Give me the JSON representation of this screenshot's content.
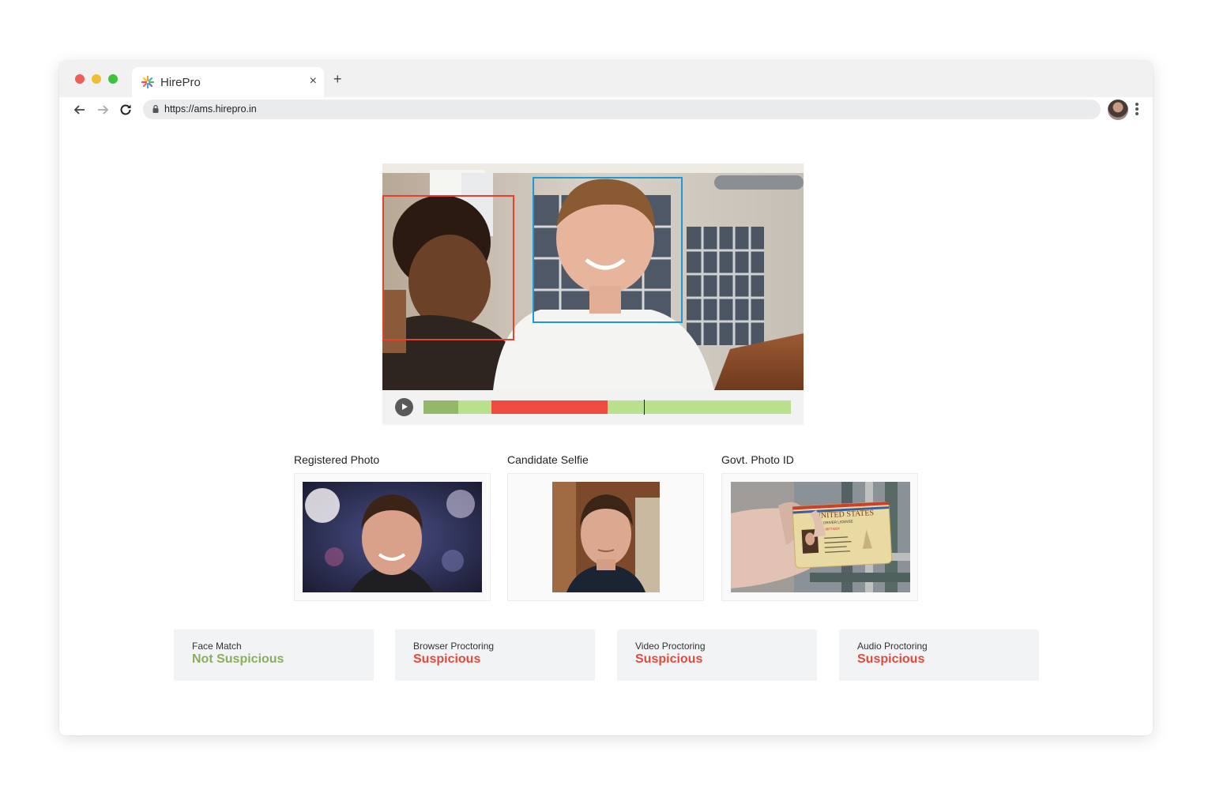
{
  "browser": {
    "tab_title": "HirePro",
    "close_glyph": "×",
    "new_tab_glyph": "+",
    "url": "https://ams.hirepro.in"
  },
  "video": {
    "timeline": {
      "segments": [
        {
          "start": 0.0,
          "end": 0.095,
          "color": "#94b86a"
        },
        {
          "start": 0.095,
          "end": 0.185,
          "color": "#b9e08d"
        },
        {
          "start": 0.185,
          "end": 0.502,
          "color": "#ef4b40"
        },
        {
          "start": 0.502,
          "end": 1.0,
          "color": "#b9e08d"
        }
      ],
      "playhead": 0.6
    }
  },
  "photos": {
    "registered": {
      "label": "Registered Photo"
    },
    "selfie": {
      "label": "Candidate Selfie"
    },
    "govt_id": {
      "label": "Govt. Photo ID",
      "card_title": "UNITED STATES",
      "card_subtitle": "DRIVER LICENSE",
      "card_number": "DL 0077422X"
    }
  },
  "status": [
    {
      "label": "Face Match",
      "value": "Not Suspicious",
      "color": "#8aaf5a"
    },
    {
      "label": "Browser Proctoring",
      "value": "Suspicious",
      "color": "#e34a3c"
    },
    {
      "label": "Video Proctoring",
      "value": "Suspicious",
      "color": "#e34a3c"
    },
    {
      "label": "Audio Proctoring",
      "value": "Suspicious",
      "color": "#e34a3c"
    }
  ],
  "colors": {
    "face_box_suspect": "#e8402f",
    "face_box_candidate": "#1c9ad6"
  }
}
